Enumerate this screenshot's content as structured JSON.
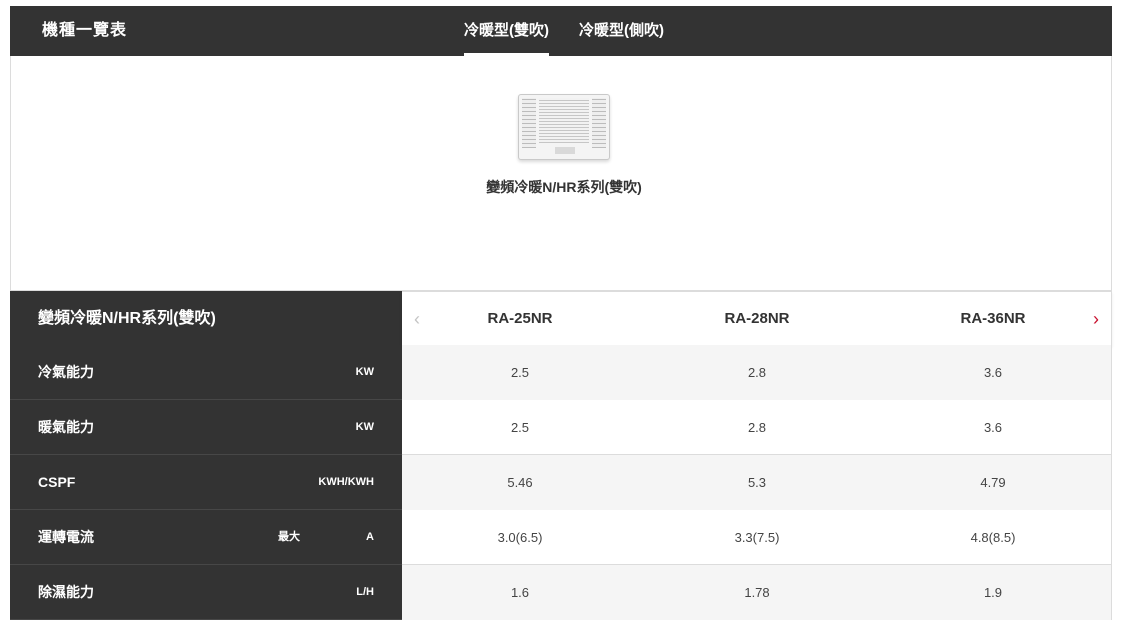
{
  "header": {
    "title": "機種一覽表",
    "tabs": [
      {
        "label": "冷暖型(雙吹)",
        "active": true
      },
      {
        "label": "冷暖型(側吹)",
        "active": false
      }
    ]
  },
  "product": {
    "name": "變頻冷暖N/HR系列(雙吹)",
    "image_icon": "window-air-conditioner-image"
  },
  "table": {
    "series_title": "變頻冷暖N/HR系列(雙吹)",
    "prev_icon": "‹",
    "next_icon": "›",
    "models": [
      "RA-25NR",
      "RA-28NR",
      "RA-36NR"
    ],
    "rows": [
      {
        "label": "冷氣能力",
        "qualifier": "",
        "unit": "KW",
        "values": [
          "2.5",
          "2.8",
          "3.6"
        ]
      },
      {
        "label": "暖氣能力",
        "qualifier": "",
        "unit": "KW",
        "values": [
          "2.5",
          "2.8",
          "3.6"
        ]
      },
      {
        "label": "CSPF",
        "qualifier": "",
        "unit": "KWH/KWH",
        "values": [
          "5.46",
          "5.3",
          "4.79"
        ]
      },
      {
        "label": "運轉電流",
        "qualifier": "最大",
        "unit": "A",
        "values": [
          "3.0(6.5)",
          "3.3(7.5)",
          "4.8(8.5)"
        ]
      },
      {
        "label": "除濕能力",
        "qualifier": "",
        "unit": "L/H",
        "values": [
          "1.6",
          "1.78",
          "1.9"
        ]
      }
    ]
  },
  "colors": {
    "header_bg": "#333333",
    "accent": "#c8102e",
    "alt_row_bg": "#f5f5f5"
  }
}
